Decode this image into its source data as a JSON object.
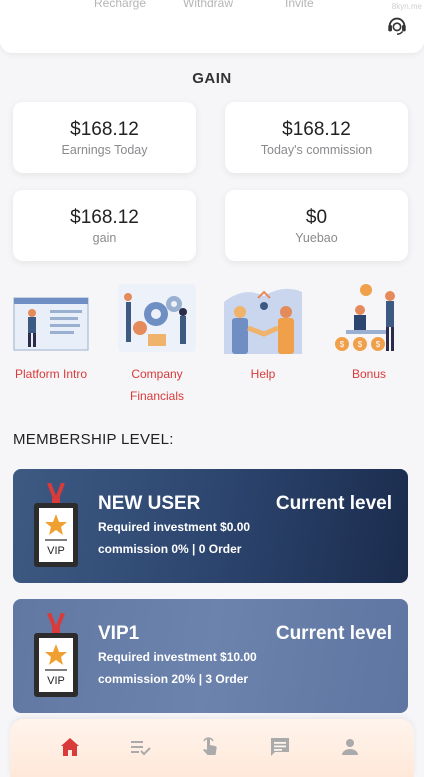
{
  "top_actions": [
    "Recharge",
    "Withdraw",
    "Invite"
  ],
  "top_watermark": "8kyn.me",
  "gain": {
    "title": "GAIN",
    "cards": [
      {
        "value": "$168.12",
        "label": "Earnings Today"
      },
      {
        "value": "$168.12",
        "label": "Today's commission"
      },
      {
        "value": "$168.12",
        "label": "gain"
      },
      {
        "value": "$0",
        "label": "Yuebao"
      }
    ]
  },
  "features": [
    {
      "label": "Platform Intro",
      "icon": "platform-illustration"
    },
    {
      "label": "Company Financials",
      "icon": "financials-illustration"
    },
    {
      "label": "Help",
      "icon": "handshake-illustration"
    },
    {
      "label": "Bonus",
      "icon": "bonus-illustration"
    }
  ],
  "membership": {
    "title": "MEMBERSHIP LEVEL:",
    "levels": [
      {
        "name": "NEW USER",
        "status": "Current level",
        "requirement": "Required investment $0.00",
        "commission": "commission 0% | 0 Order",
        "badge_text": "VIP"
      },
      {
        "name": "VIP1",
        "status": "Current level",
        "requirement": "Required investment $10.00",
        "commission": "commission 20% | 3 Order",
        "badge_text": "VIP"
      }
    ]
  },
  "tabbar": {
    "items": [
      "home-icon",
      "orders-icon",
      "grab-icon",
      "chat-icon",
      "profile-icon"
    ],
    "active_color": "#d93a3a",
    "inactive_color": "#aaaaaa"
  },
  "colors": {
    "accent": "#d93a3a",
    "card_dark": "#2d4670",
    "card_light": "#6c83ad"
  }
}
